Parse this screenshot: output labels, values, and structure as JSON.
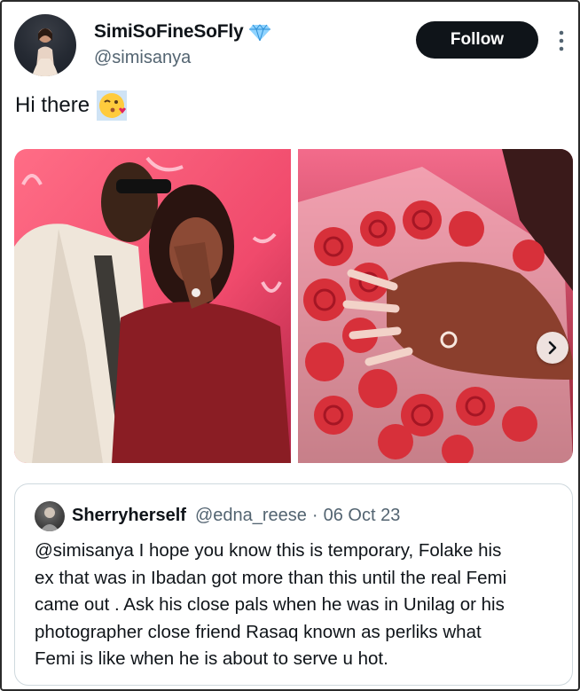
{
  "author": {
    "display_name": "SimiSoFineSoFly",
    "handle": "@simisanya"
  },
  "follow_label": "Follow",
  "tweet": {
    "text": "Hi there",
    "emoji": "face-blowing-kiss"
  },
  "media": {
    "photos": [
      "couple-kiss-photo",
      "ring-roses-bouquet-photo"
    ]
  },
  "quoted_tweet": {
    "display_name": "Sherryherself",
    "handle": "@edna_reese",
    "separator": "·",
    "date": "06 Oct 23",
    "lines": [
      "@simisanya  I hope you know this is temporary, Folake his",
      "ex that was in Ibadan got more than this until the real Femi",
      "came out .  Ask his close pals when he was in Unilag or his",
      "photographer close friend Rasaq known as perliks what",
      "Femi is like when he is about to serve u hot."
    ]
  },
  "colors": {
    "follow_bg": "#0f1419",
    "verified_blue": "#1d9bf0",
    "secondary_text": "#536471",
    "border": "#cfd9de"
  }
}
